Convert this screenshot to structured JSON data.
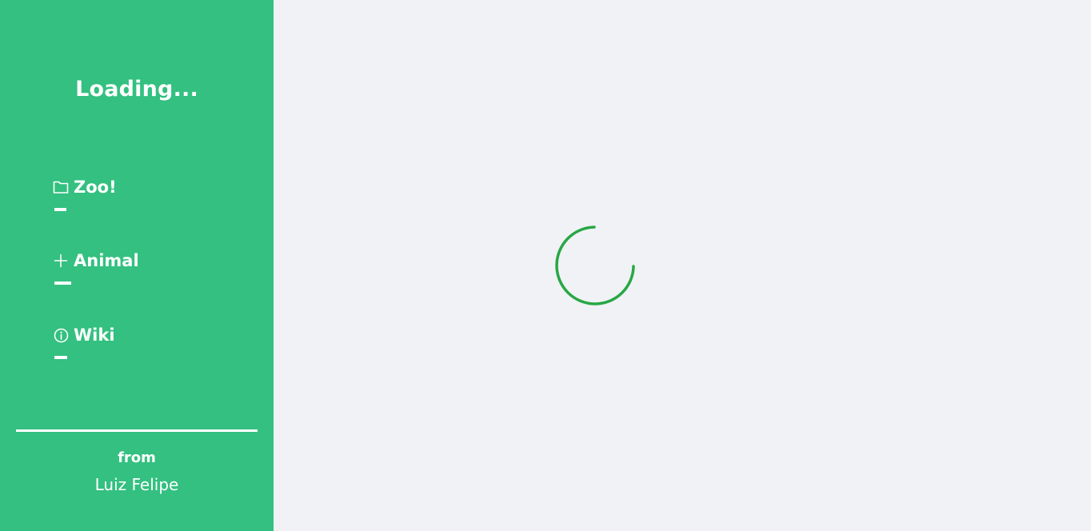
{
  "sidebar": {
    "title": "Loading...",
    "nav": [
      {
        "label": "Zoo!",
        "icon": "folder-icon"
      },
      {
        "label": "Animal",
        "icon": "plus-icon"
      },
      {
        "label": "Wiki",
        "icon": "info-circle-icon"
      }
    ],
    "footer": {
      "from_label": "from",
      "author": "Luiz Felipe"
    }
  },
  "main": {
    "spinner": {
      "icon": "loading-spinner-icon",
      "color": "#28a745"
    }
  },
  "colors": {
    "sidebar_bg": "#33c080",
    "main_bg": "#f0f2f5",
    "text": "#ffffff"
  }
}
